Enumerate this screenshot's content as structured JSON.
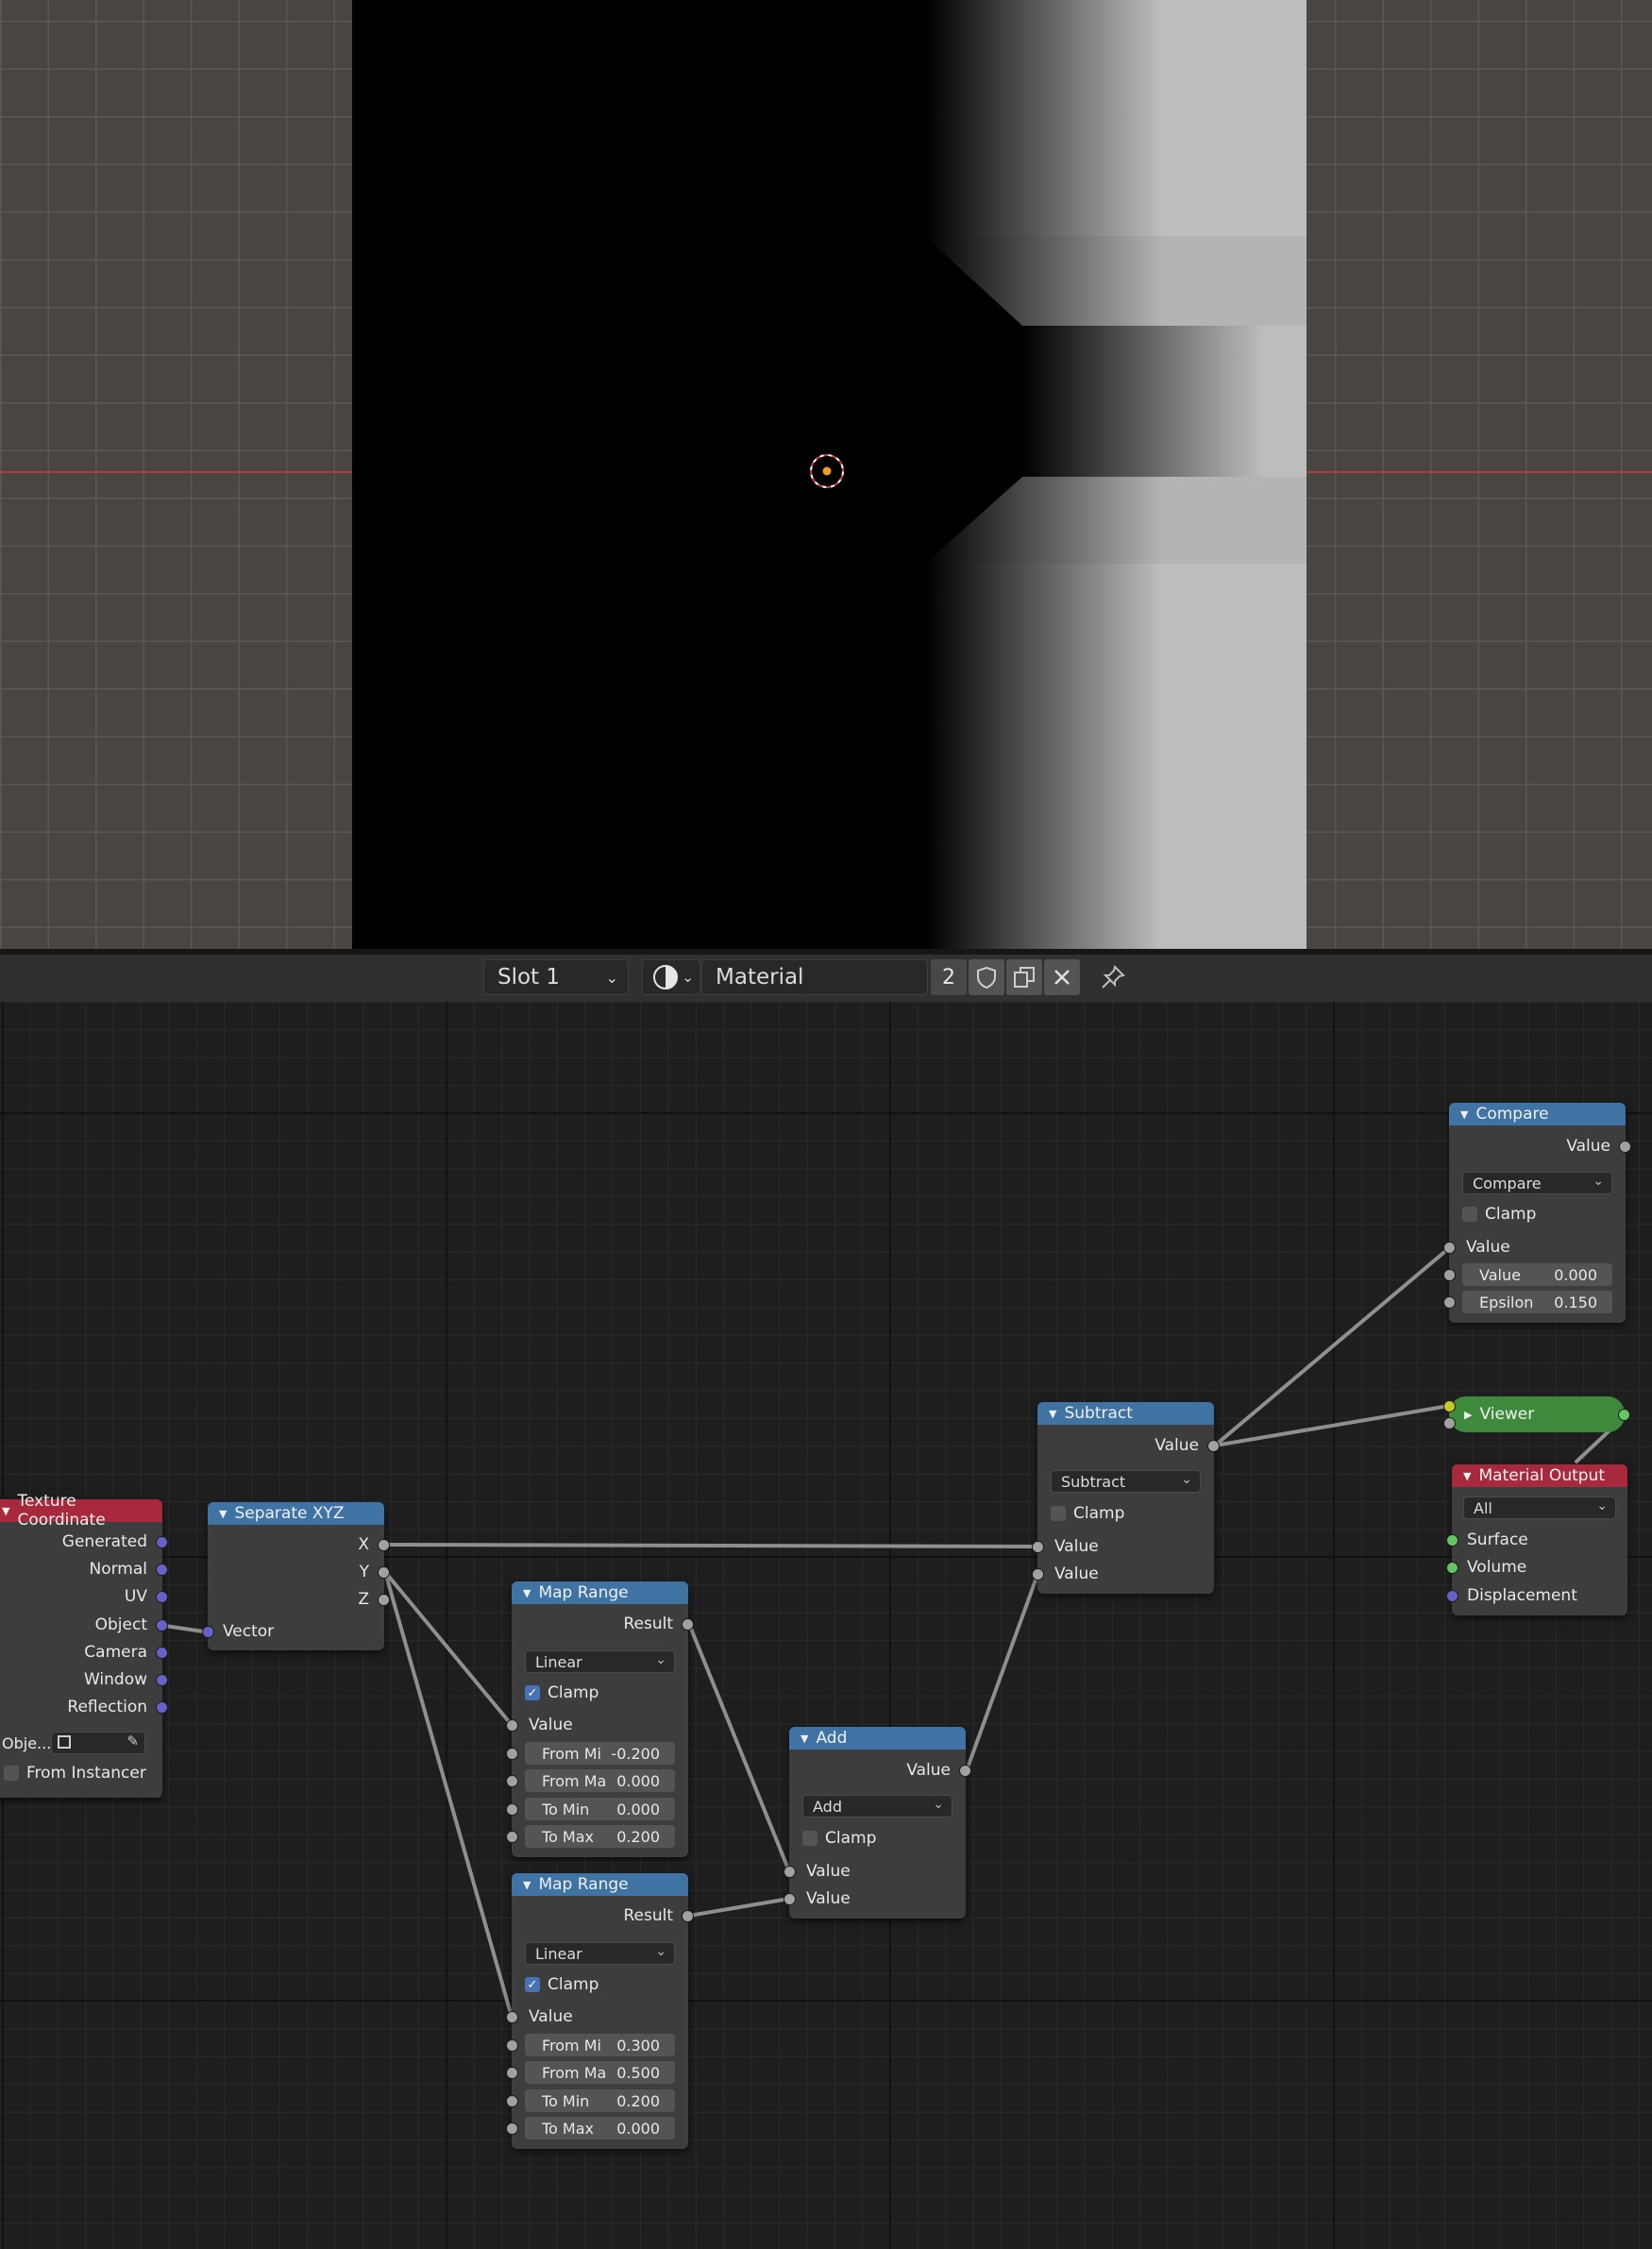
{
  "header": {
    "slot": "Slot 1",
    "material_name": "Material",
    "user_count": "2"
  },
  "nodes": {
    "texture_coordinate": {
      "title": "Texture Coordinate",
      "outputs": [
        "Generated",
        "Normal",
        "UV",
        "Object",
        "Camera",
        "Window",
        "Reflection"
      ],
      "object_label": "Obje...",
      "from_instancer": "From Instancer"
    },
    "separate_xyz": {
      "title": "Separate XYZ",
      "outputs": [
        "X",
        "Y",
        "Z"
      ],
      "input": "Vector"
    },
    "map_range_1": {
      "title": "Map Range",
      "output": "Result",
      "mode": "Linear",
      "clamp": "Clamp",
      "clamp_checked": true,
      "input_value": "Value",
      "fields": [
        {
          "label": "From Mi",
          "value": "-0.200"
        },
        {
          "label": "From Ma",
          "value": "0.000"
        },
        {
          "label": "To Min",
          "value": "0.000"
        },
        {
          "label": "To Max",
          "value": "0.200"
        }
      ]
    },
    "map_range_2": {
      "title": "Map Range",
      "output": "Result",
      "mode": "Linear",
      "clamp": "Clamp",
      "clamp_checked": true,
      "input_value": "Value",
      "fields": [
        {
          "label": "From Mi",
          "value": "0.300"
        },
        {
          "label": "From Ma",
          "value": "0.500"
        },
        {
          "label": "To Min",
          "value": "0.200"
        },
        {
          "label": "To Max",
          "value": "0.000"
        }
      ]
    },
    "add": {
      "title": "Add",
      "output": "Value",
      "operation": "Add",
      "clamp": "Clamp",
      "inputs": [
        "Value",
        "Value"
      ]
    },
    "subtract": {
      "title": "Subtract",
      "output": "Value",
      "operation": "Subtract",
      "clamp": "Clamp",
      "inputs": [
        "Value",
        "Value"
      ]
    },
    "compare": {
      "title": "Compare",
      "output": "Value",
      "operation": "Compare",
      "clamp": "Clamp",
      "input_value": "Value",
      "fields": [
        {
          "label": "Value",
          "value": "0.000"
        },
        {
          "label": "Epsilon",
          "value": "0.150"
        }
      ]
    },
    "viewer": {
      "title": "Viewer"
    },
    "material_output": {
      "title": "Material Output",
      "target": "All",
      "inputs": [
        "Surface",
        "Volume",
        "Displacement"
      ]
    }
  },
  "colors": {
    "node_header_math": "#3e73a3",
    "node_header_input": "#a9293c",
    "viewer_node": "#3d8a3d",
    "socket_float": "#a1a1a1",
    "socket_vector": "#6363c7",
    "socket_shader": "#62c762"
  }
}
